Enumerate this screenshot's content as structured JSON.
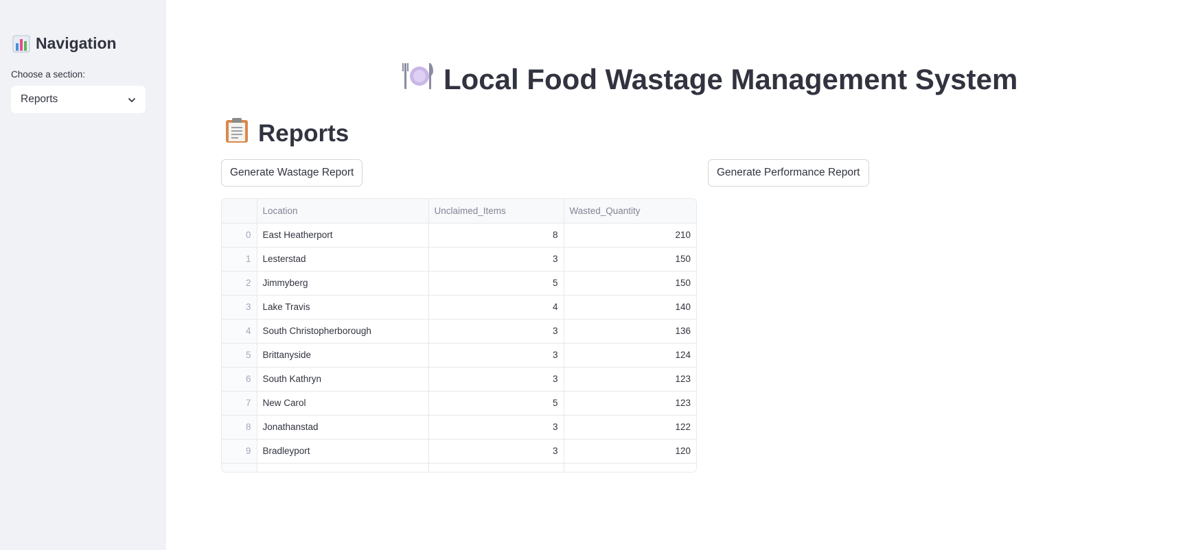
{
  "sidebar": {
    "title": "Navigation",
    "title_icon": "bar-chart-icon",
    "select_label": "Choose a section:",
    "select_value": "Reports"
  },
  "main": {
    "title": "Local Food Wastage Management System",
    "title_icon": "plate-cutlery-icon",
    "section_title": "Reports",
    "section_icon": "clipboard-icon",
    "buttons": {
      "wastage": "Generate Wastage Report",
      "performance": "Generate Performance Report"
    }
  },
  "table": {
    "columns": [
      "",
      "Location",
      "Unclaimed_Items",
      "Wasted_Quantity"
    ],
    "rows": [
      {
        "index": "0",
        "location": "East Heatherport",
        "unclaimed": "8",
        "wasted": "210"
      },
      {
        "index": "1",
        "location": "Lesterstad",
        "unclaimed": "3",
        "wasted": "150"
      },
      {
        "index": "2",
        "location": "Jimmyberg",
        "unclaimed": "5",
        "wasted": "150"
      },
      {
        "index": "3",
        "location": "Lake Travis",
        "unclaimed": "4",
        "wasted": "140"
      },
      {
        "index": "4",
        "location": "South Christopherborough",
        "unclaimed": "3",
        "wasted": "136"
      },
      {
        "index": "5",
        "location": "Brittanyside",
        "unclaimed": "3",
        "wasted": "124"
      },
      {
        "index": "6",
        "location": "South Kathryn",
        "unclaimed": "3",
        "wasted": "123"
      },
      {
        "index": "7",
        "location": "New Carol",
        "unclaimed": "5",
        "wasted": "123"
      },
      {
        "index": "8",
        "location": "Jonathanstad",
        "unclaimed": "3",
        "wasted": "122"
      },
      {
        "index": "9",
        "location": "Bradleyport",
        "unclaimed": "3",
        "wasted": "120"
      }
    ]
  },
  "colors": {
    "sidebar_bg": "#f0f2f6",
    "text": "#31333f",
    "muted": "#808495",
    "border": "#e6e8ee"
  }
}
